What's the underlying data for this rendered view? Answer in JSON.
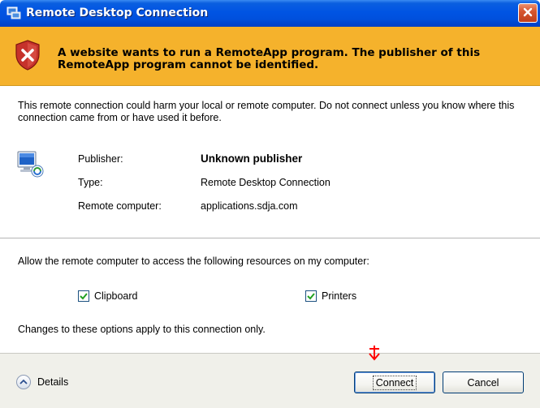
{
  "window": {
    "title": "Remote Desktop Connection"
  },
  "banner": {
    "message": "A website wants to run a RemoteApp program. The publisher of this RemoteApp program cannot be identified."
  },
  "body": {
    "warning": "This remote connection could harm your local or remote computer. Do not connect unless you know where this connection came from or have used it before.",
    "info": [
      {
        "label": "Publisher:",
        "value": "Unknown publisher"
      },
      {
        "label": "Type:",
        "value": "Remote Desktop Connection"
      },
      {
        "label": "Remote computer:",
        "value": "applications.sdja.com"
      }
    ],
    "allow_text": "Allow the remote computer to access the following resources on my computer:",
    "checkboxes": [
      {
        "label": "Clipboard",
        "checked": true
      },
      {
        "label": "Printers",
        "checked": true
      }
    ],
    "note": "Changes to these options apply to this connection only."
  },
  "footer": {
    "details_label": "Details",
    "connect_label": "Connect",
    "cancel_label": "Cancel"
  },
  "colors": {
    "titlebar": "#0054e3",
    "banner": "#f5b22c",
    "close": "#d6562f",
    "annotation_arrow": "#ff0000"
  },
  "icons": [
    "remote-desktop-icon",
    "close-icon",
    "shield-error-icon",
    "computer-icon",
    "checkmark-icon",
    "chevron-up-icon",
    "annotation-arrow-icon"
  ]
}
